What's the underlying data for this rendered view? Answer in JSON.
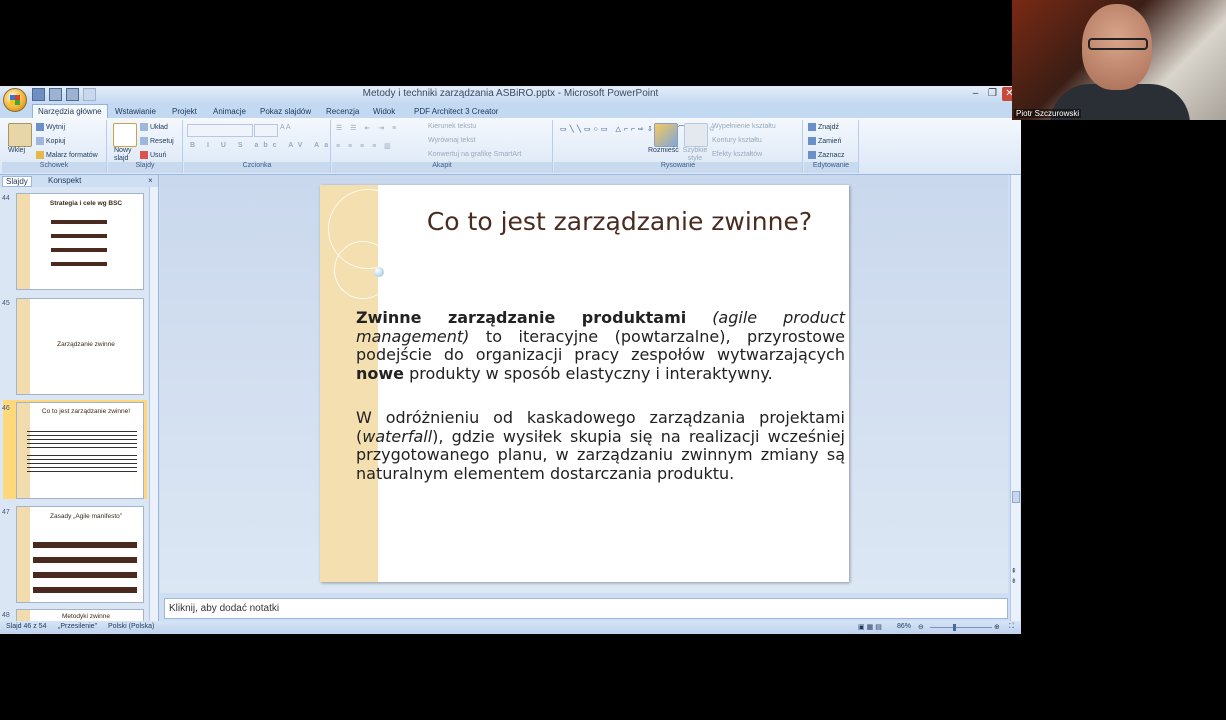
{
  "window": {
    "title": "Metody i techniki zarządzania ASBiRO.pptx - Microsoft PowerPoint"
  },
  "tabs": [
    "Narzędzia główne",
    "Wstawianie",
    "Projekt",
    "Animacje",
    "Pokaz slajdów",
    "Recenzja",
    "Widok",
    "PDF Architect 3 Creator"
  ],
  "ribbon": {
    "clipboard": {
      "label": "Schowek",
      "paste": "Wklej",
      "cut": "Wytnij",
      "copy": "Kopiuj",
      "painter": "Malarz formatów"
    },
    "slides": {
      "label": "Slajdy",
      "new_slide": "Nowy slajd",
      "layout": "Układ",
      "reset": "Resetuj",
      "delete": "Usuń"
    },
    "font": {
      "label": "Czcionka"
    },
    "paragraph": {
      "label": "Akapit",
      "direction": "Kierunek tekstu",
      "align": "Wyrównaj tekst",
      "smartart": "Konwertuj na grafikę SmartArt"
    },
    "drawing": {
      "label": "Rysowanie",
      "arrange": "Rozmieść",
      "quick_styles": "Szybkie style",
      "fill": "Wypełnienie kształtu",
      "outline": "Kontury kształtu",
      "effects": "Efekty kształtów"
    },
    "editing": {
      "label": "Edytowanie",
      "find": "Znajdź",
      "replace": "Zamień",
      "select": "Zaznacz"
    }
  },
  "panel": {
    "tab_slides": "Slajdy",
    "tab_outline": "Konspekt",
    "close": "×"
  },
  "thumbnails": [
    {
      "num": "44",
      "title": "Strategia i cele wg BSC"
    },
    {
      "num": "45",
      "title": "Zarządzanie zwinne"
    },
    {
      "num": "46",
      "title": "Co to jest zarządzanie zwinne!"
    },
    {
      "num": "47",
      "title": "Zasady „Agile manifesto”"
    },
    {
      "num": "48",
      "title": "Metodyki zwinne"
    }
  ],
  "slide": {
    "title": "Co to jest zarządzanie zwinne?",
    "p1_bold": "Zwinne zarządzanie produktami",
    "p1_italic": "(agile product management)",
    "p1_rest": " to iteracyjne (powtarzalne), przyrostowe podejście do organizacji pracy zespołów wytwarzających ",
    "p1_bold2": "nowe",
    "p1_end": " produkty w sposób elastyczny i interaktywny.",
    "p2_start": "W odróżnieniu od kaskadowego zarządzania projektami (",
    "p2_italic": "waterfall",
    "p2_end": "), gdzie wysiłek skupia się na realizacji wcześniej przygotowanego planu, w zarządzaniu zwinnym zmiany są naturalnym elementem dostarczania produktu."
  },
  "notes": {
    "placeholder": "Kliknij, aby dodać notatki"
  },
  "status": {
    "slide": "Slajd 46 z 54",
    "theme": "„Przesilenie”",
    "language": "Polski (Polska)",
    "zoom": "86%"
  },
  "webcam": {
    "name": "Piotr Szczurowski"
  }
}
